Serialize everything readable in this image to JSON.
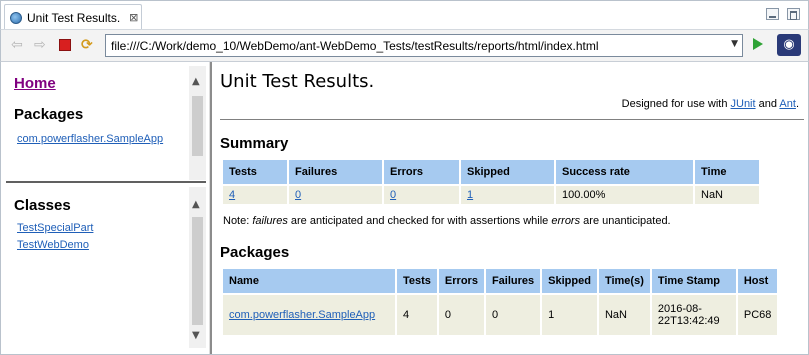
{
  "tab": {
    "title": "Unit Test Results.",
    "close": "⊠",
    "globe_icon": "globe-icon"
  },
  "toolbar": {
    "back": "⇦",
    "forward": "⇨",
    "refresh": "⟳",
    "url": "file:///C:/Work/demo_10/WebDemo/ant-WebDemo_Tests/testResults/reports/html/index.html",
    "dropdown": "▼",
    "eclipse": "◉"
  },
  "left": {
    "home": "Home",
    "packages_heading": "Packages",
    "packages": [
      "com.powerflasher.SampleApp"
    ],
    "classes_heading": "Classes",
    "classes": [
      "TestSpecialPart",
      "TestWebDemo"
    ],
    "scroll_up": "▲",
    "scroll_down": "▼"
  },
  "main": {
    "title": "Unit Test Results.",
    "designed_prefix": "Designed for use with ",
    "junit": "JUnit",
    "and": " and ",
    "ant": "Ant",
    "period": ".",
    "summary_heading": "Summary",
    "summary": {
      "headers": [
        "Tests",
        "Failures",
        "Errors",
        "Skipped",
        "Success rate",
        "Time"
      ],
      "row": [
        "4",
        "0",
        "0",
        "1",
        "100.00%",
        "NaN"
      ]
    },
    "note": {
      "prefix": "Note: ",
      "failures": "failures",
      "middle": " are anticipated and checked for with assertions while ",
      "errors": "errors",
      "suffix": " are unanticipated."
    },
    "packages_heading": "Packages",
    "packages": {
      "headers": [
        "Name",
        "Tests",
        "Errors",
        "Failures",
        "Skipped",
        "Time(s)",
        "Time Stamp",
        "Host"
      ],
      "rows": [
        [
          "com.powerflasher.SampleApp",
          "4",
          "0",
          "0",
          "1",
          "NaN",
          "2016-08-22T13:42:49",
          "PC68"
        ]
      ]
    }
  },
  "colors": {
    "table_header": "#a6caf0",
    "table_cell": "#eeeee0",
    "link": "#1f5fb8",
    "visited": "#800080"
  }
}
